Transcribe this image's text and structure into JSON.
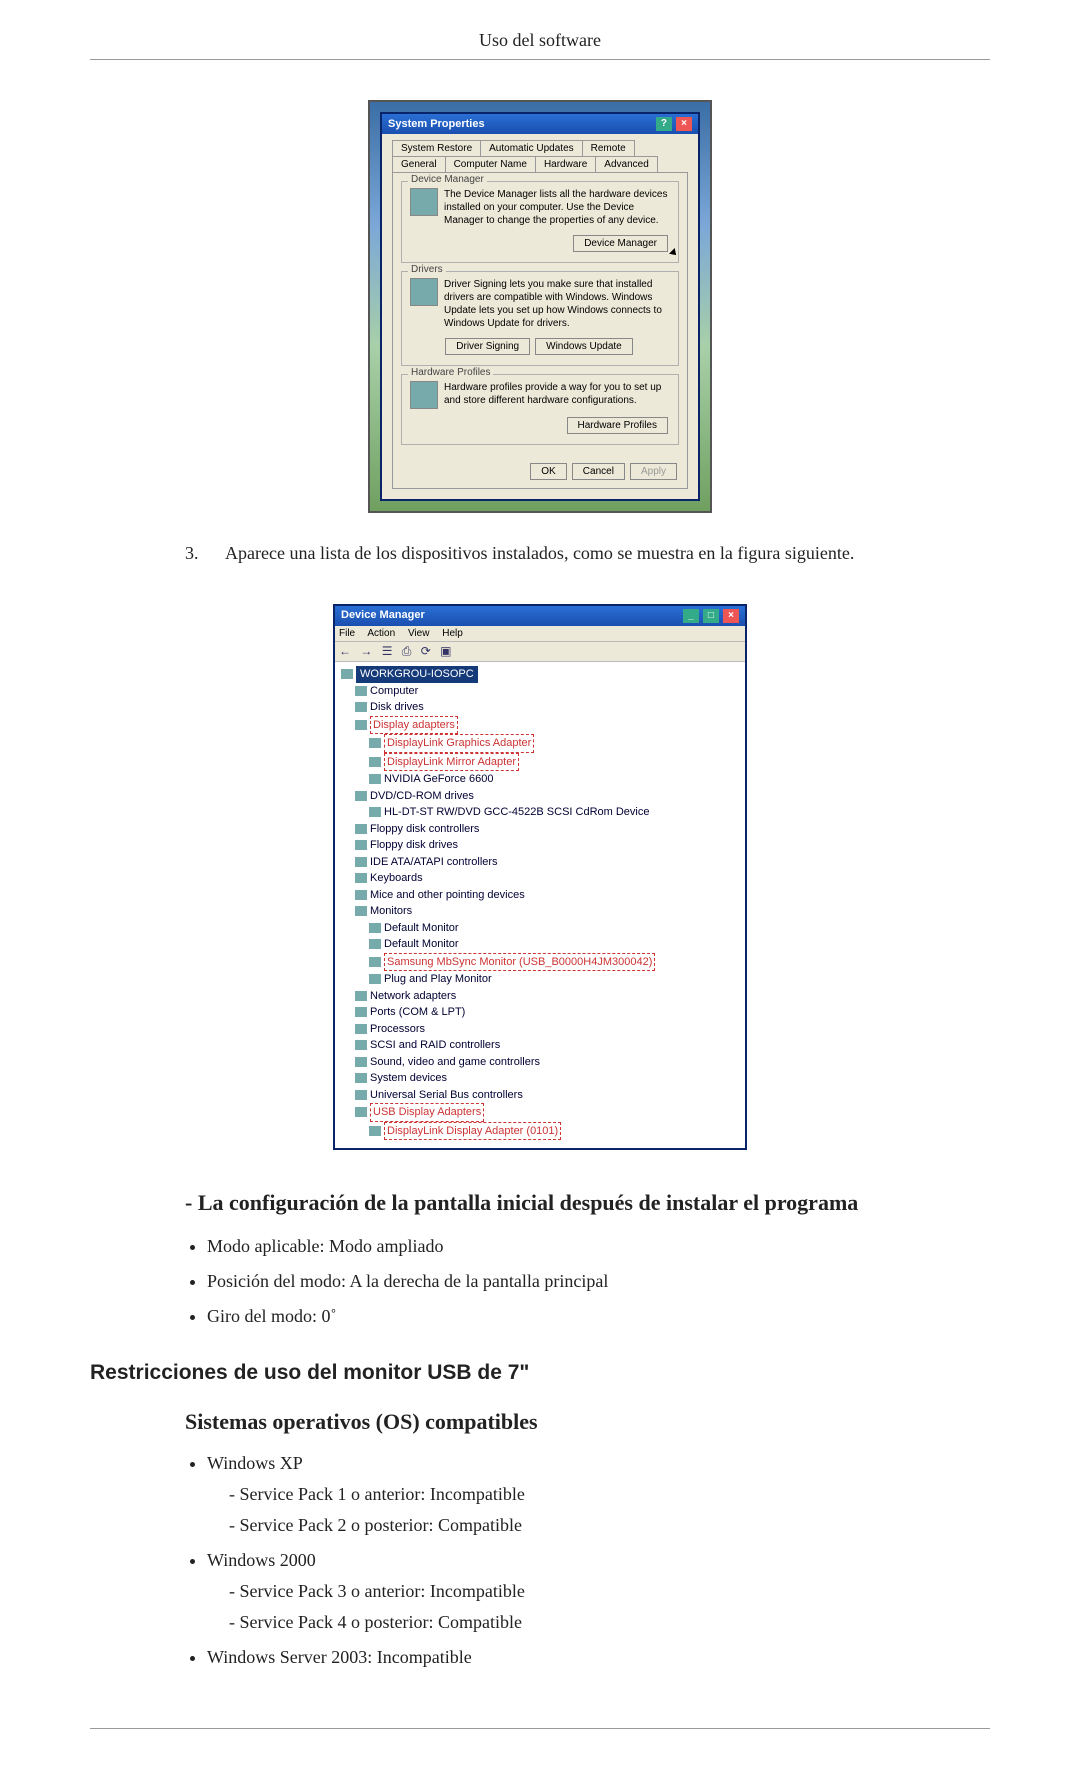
{
  "header": {
    "title": "Uso del software"
  },
  "dlg1": {
    "title": "System Properties",
    "tabs_row1": [
      "System Restore",
      "Automatic Updates",
      "Remote"
    ],
    "tabs_row2": [
      "General",
      "Computer Name",
      "Hardware",
      "Advanced"
    ],
    "group_dm": {
      "title": "Device Manager",
      "text": "The Device Manager lists all the hardware devices installed on your computer. Use the Device Manager to change the properties of any device.",
      "btn": "Device Manager"
    },
    "group_drv": {
      "title": "Drivers",
      "text": "Driver Signing lets you make sure that installed drivers are compatible with Windows. Windows Update lets you set up how Windows connects to Windows Update for drivers.",
      "btn1": "Driver Signing",
      "btn2": "Windows Update"
    },
    "group_hw": {
      "title": "Hardware Profiles",
      "text": "Hardware profiles provide a way for you to set up and store different hardware configurations.",
      "btn": "Hardware Profiles"
    },
    "footer": {
      "ok": "OK",
      "cancel": "Cancel",
      "apply": "Apply"
    }
  },
  "step3": {
    "num": "3.",
    "text": "Aparece una lista de los dispositivos instalados, como se muestra en la figura siguiente."
  },
  "dm": {
    "title": "Device Manager",
    "menu": [
      "File",
      "Action",
      "View",
      "Help"
    ],
    "root": "WORKGROU-IOSOPC",
    "nodes_top": [
      "Computer",
      "Disk drives"
    ],
    "display": {
      "label": "Display adapters",
      "items": [
        "DisplayLink Graphics Adapter",
        "DisplayLink Mirror Adapter",
        "NVIDIA GeForce 6600"
      ]
    },
    "dvd": {
      "label": "DVD/CD-ROM drives",
      "item": "HL-DT-ST RW/DVD GCC-4522B SCSI CdRom Device"
    },
    "mid": [
      "Floppy disk controllers",
      "Floppy disk drives",
      "IDE ATA/ATAPI controllers",
      "Keyboards",
      "Mice and other pointing devices"
    ],
    "monitors": {
      "label": "Monitors",
      "items": [
        "Default Monitor",
        "Default Monitor",
        "Samsung MbSync Monitor (USB_B0000H4JM300042)",
        "Plug and Play Monitor"
      ]
    },
    "after": [
      "Network adapters",
      "Ports (COM & LPT)",
      "Processors",
      "SCSI and RAID controllers",
      "Sound, video and game controllers",
      "System devices",
      "Universal Serial Bus controllers"
    ],
    "usb": {
      "label": "USB Display Adapters",
      "item": "DisplayLink Display Adapter (0101)"
    }
  },
  "cfg": {
    "heading": "- La configuración de la pantalla inicial después de instalar el programa",
    "items": [
      "Modo aplicable: Modo ampliado",
      "Posición del modo: A la derecha de la pantalla principal",
      "Giro del modo: 0˚"
    ]
  },
  "restr": {
    "h2": "Restricciones de uso del monitor USB de 7\"",
    "h3": "Sistemas operativos (OS) compatibles",
    "xp": {
      "label": "Windows XP",
      "sp1": "- Service Pack 1 o anterior: Incompatible",
      "sp2": "- Service Pack 2 o posterior: Compatible"
    },
    "w2k": {
      "label": "Windows 2000",
      "sp3": "- Service Pack 3 o anterior: Incompatible",
      "sp4": "- Service Pack 4 o posterior: Compatible"
    },
    "ws2003": "Windows Server 2003: Incompatible"
  }
}
